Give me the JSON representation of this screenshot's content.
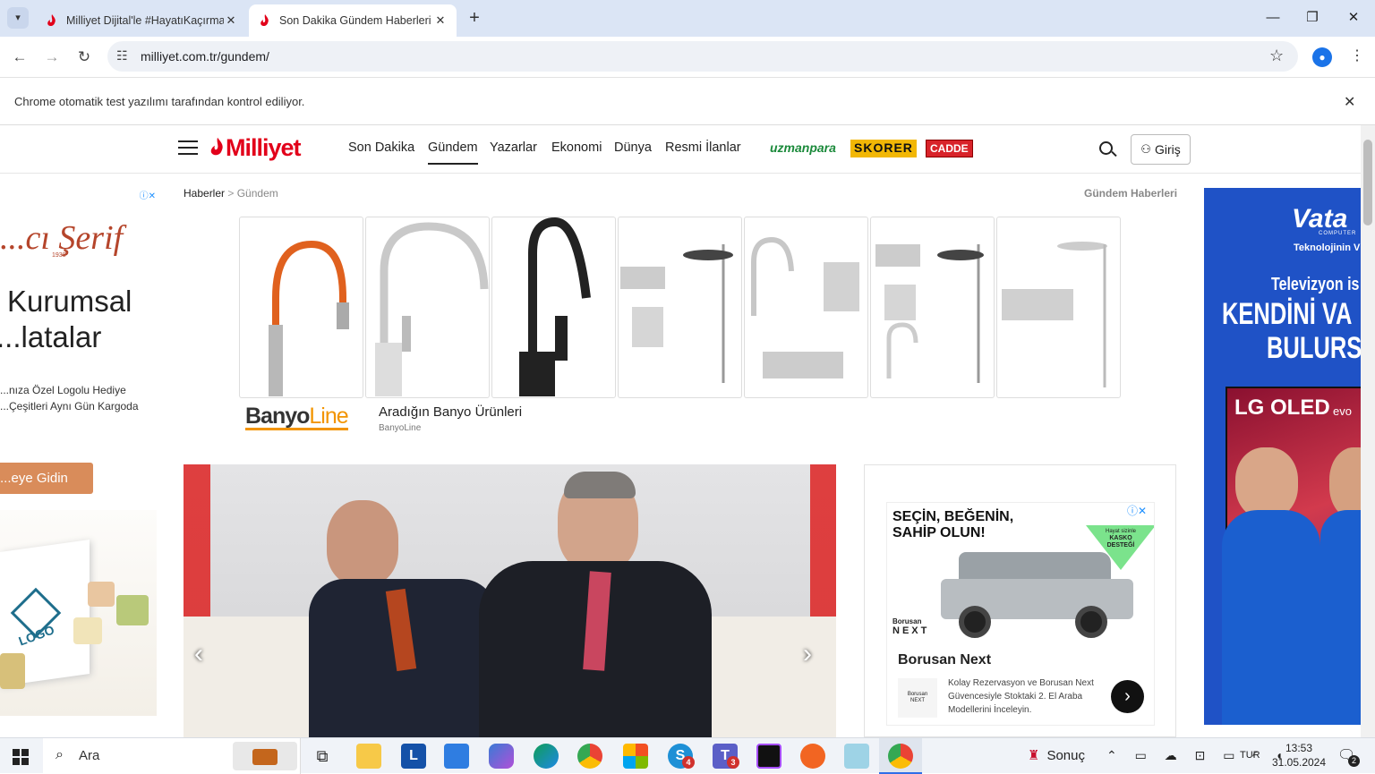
{
  "browser": {
    "tabs": [
      {
        "title": "Milliyet Dijital'le #HayatıKaçırma"
      },
      {
        "title": "Son Dakika Gündem Haberleri"
      }
    ],
    "url": "milliyet.com.tr/gundem/",
    "infobar": "Chrome otomatik test yazılımı tarafından kontrol ediliyor."
  },
  "site": {
    "logo": "Milliyet",
    "nav": [
      "Son Dakika",
      "Gündem",
      "Yazarlar",
      "Ekonomi",
      "Dünya",
      "Resmi İlanlar"
    ],
    "partners": [
      "uzmanpara",
      "SKORER",
      "CADDE"
    ],
    "login": "Giriş",
    "breadcrumb": {
      "home": "Haberler",
      "current": "Gündem"
    },
    "section_title": "Gündem Haberleri"
  },
  "ads": {
    "left": {
      "brand": "...cı Şerif",
      "brand_sub": "1938",
      "heading1": "Kurumsal",
      "heading2": "...latalar",
      "line1": "...nıza Özel Logolu Hediye",
      "line2": "...Çeşitleri Aynı Gün Kargoda",
      "cta": "...eye Gidin",
      "logo_text": "LOGO"
    },
    "banyo": {
      "brand_a": "Banyo",
      "brand_b": "Line",
      "title": "Aradığın Banyo Ürünleri",
      "source": "BanyoLine"
    },
    "borusan": {
      "headline1": "SEÇİN, BEĞENİN,",
      "headline2": "SAHİP OLUN!",
      "badge1": "Hayat sizinle",
      "badge2": "KASKO",
      "badge3": "DESTEĞİ",
      "logo1": "Borusan",
      "logo2": "NEXT",
      "title": "Borusan Next",
      "desc": "Kolay Rezervasyon ve Borusan Next Güvencesiyle Stoktaki 2. El Araba Modellerini İnceleyin."
    },
    "right": {
      "brand": "Vata",
      "brand_sub": "COMPUTER",
      "tagline": "Teknolojinin V",
      "line1": "Televizyon is",
      "line2": "KENDİNİ VA",
      "line3": "BULURS",
      "product": "LG OLED",
      "product_sub": "evo"
    }
  },
  "taskbar": {
    "search": "Ara",
    "weather": "Sonuç",
    "lang": "TUR",
    "time": "13:53",
    "date": "31.05.2024",
    "notif_count": "2",
    "badge_s": "4",
    "badge_t": "3"
  }
}
